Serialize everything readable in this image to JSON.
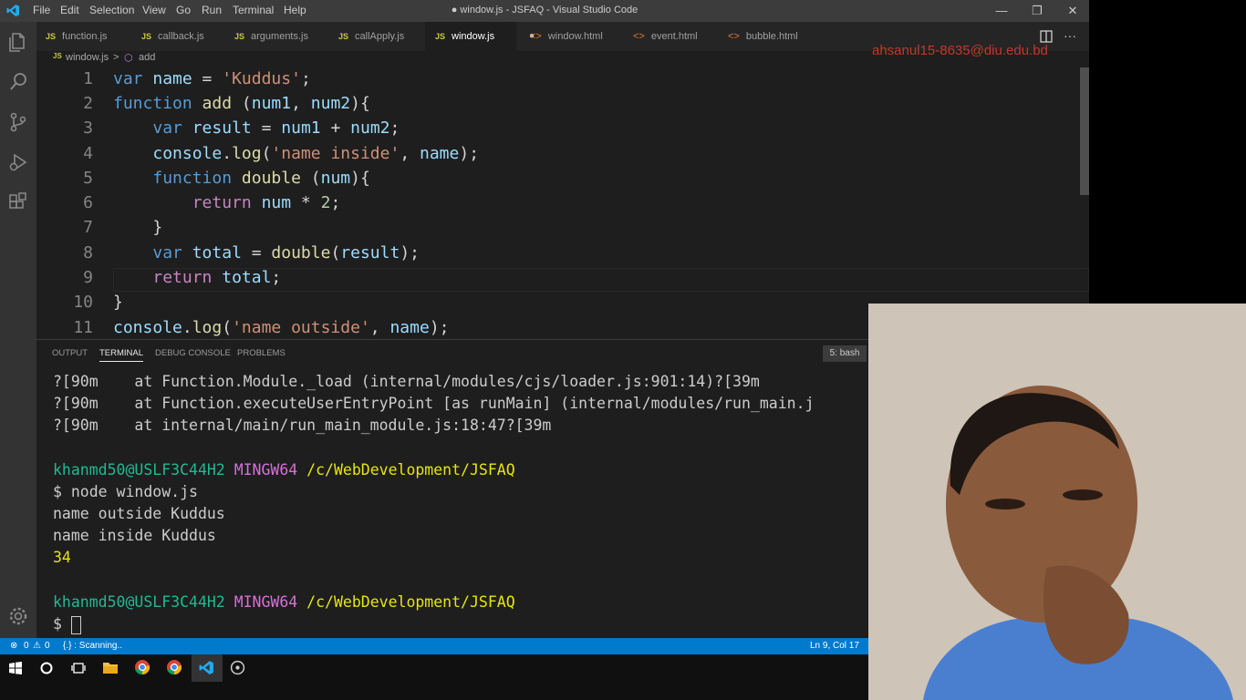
{
  "titlebar": {
    "menu": [
      "File",
      "Edit",
      "Selection",
      "View",
      "Go",
      "Run",
      "Terminal",
      "Help"
    ],
    "title": "● window.js - JSFAQ - Visual Studio Code",
    "controls": [
      "—",
      "❐",
      "✕"
    ]
  },
  "tabs": [
    {
      "label": "function.js",
      "kind": "js"
    },
    {
      "label": "callback.js",
      "kind": "js"
    },
    {
      "label": "arguments.js",
      "kind": "js"
    },
    {
      "label": "callApply.js",
      "kind": "js"
    },
    {
      "label": "window.js",
      "kind": "js",
      "active": true,
      "dirty": "●"
    },
    {
      "label": "window.html",
      "kind": "html"
    },
    {
      "label": "event.html",
      "kind": "html"
    },
    {
      "label": "bubble.html",
      "kind": "html"
    }
  ],
  "breadcrumb": {
    "file": "window.js",
    "separator": ">",
    "symbol": "add"
  },
  "overlay_email": "ahsanul15-8635@diu.edu.bd",
  "editor": {
    "line_numbers": [
      "1",
      "2",
      "3",
      "4",
      "5",
      "6",
      "7",
      "8",
      "9",
      "10",
      "11"
    ],
    "lines": [
      "var name = 'Kuddus';",
      "function add (num1, num2){",
      "    var result = num1 + num2;",
      "    console.log('name inside', name);",
      "    function double (num){",
      "        return num * 2;",
      "    }",
      "    var total = double(result);",
      "    return total;",
      "}",
      "console.log('name outside', name);"
    ]
  },
  "panel": {
    "tabs": [
      "OUTPUT",
      "TERMINAL",
      "DEBUG CONSOLE",
      "PROBLEMS"
    ],
    "active_tab": "TERMINAL",
    "terminal_selector": "5: bash",
    "terminal": {
      "trace": [
        "?[90m    at Function.Module._load (internal/modules/cjs/loader.js:901:14)?[39m",
        "?[90m    at Function.executeUserEntryPoint [as runMain] (internal/modules/run_main.j",
        "?[90m    at internal/main/run_main_module.js:18:47?[39m"
      ],
      "prompt_user": "khanmd50@USLF3C44H2",
      "prompt_sys": "MINGW64",
      "prompt_path": "/c/WebDevelopment/JSFAQ",
      "command": "$ node window.js",
      "output": [
        "name outside Kuddus",
        "name inside Kuddus"
      ],
      "result": "34",
      "dollar": "$"
    }
  },
  "statusbar": {
    "errors": "0",
    "warnings": "0",
    "scanning": "{.} : Scanning..",
    "position": "Ln 9, Col 17"
  },
  "colors": {
    "accent": "#007acc",
    "keyword": "#569cd6",
    "string": "#ce9178",
    "function": "#dcdcaa",
    "variable": "#9cdcfe"
  },
  "activity_icons": [
    "files-icon",
    "search-icon",
    "source-control-icon",
    "run-debug-icon",
    "extensions-icon",
    "settings-gear-icon"
  ],
  "taskbar_icons": [
    "windows-start-icon",
    "cortana-icon",
    "task-view-icon",
    "file-explorer-icon",
    "chrome-icon",
    "chrome-canary-icon",
    "vscode-icon",
    "app-icon"
  ]
}
